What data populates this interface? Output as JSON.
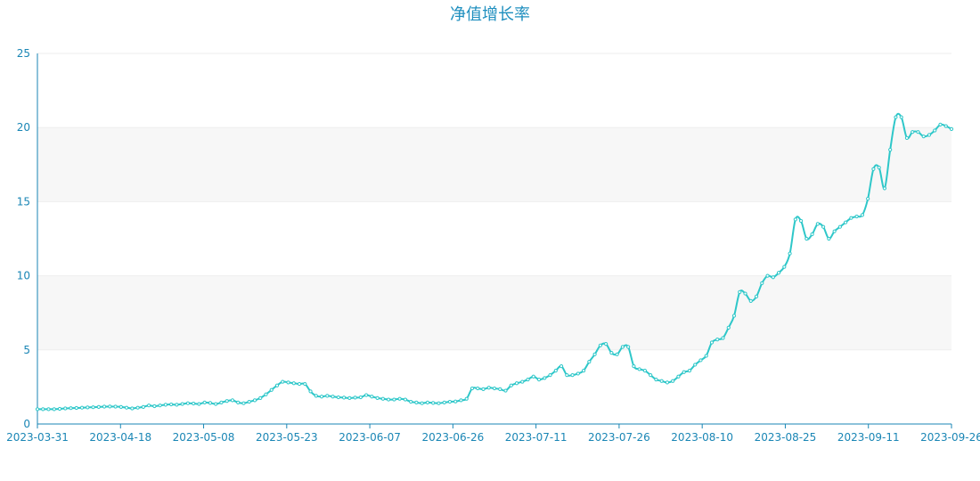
{
  "chart_data": {
    "type": "line",
    "title": "净值增长率",
    "xlabel": "",
    "ylabel": "",
    "ylim": [
      0,
      25
    ],
    "yticks": [
      0,
      5,
      10,
      15,
      20,
      25
    ],
    "x_tick_labels": [
      "2023-03-31",
      "2023-04-18",
      "2023-05-08",
      "2023-05-23",
      "2023-06-07",
      "2023-06-26",
      "2023-07-11",
      "2023-07-26",
      "2023-08-10",
      "2023-08-25",
      "2023-09-11",
      "2023-09-26"
    ],
    "grid": "horizontal bands",
    "legend": "none",
    "line_color": "#2ec7c9",
    "axis_color": "#1a86b5",
    "series": [
      {
        "values": [
          1.0,
          1.0,
          1.0,
          1.0,
          1.02,
          1.05,
          1.07,
          1.08,
          1.1,
          1.12,
          1.13,
          1.15,
          1.17,
          1.18,
          1.17,
          1.15,
          1.1,
          1.05,
          1.1,
          1.15,
          1.25,
          1.2,
          1.25,
          1.3,
          1.32,
          1.3,
          1.35,
          1.4,
          1.38,
          1.35,
          1.45,
          1.42,
          1.35,
          1.45,
          1.55,
          1.6,
          1.45,
          1.4,
          1.5,
          1.6,
          1.75,
          2.0,
          2.3,
          2.6,
          2.85,
          2.8,
          2.75,
          2.7,
          2.7,
          2.2,
          1.9,
          1.85,
          1.9,
          1.85,
          1.8,
          1.78,
          1.75,
          1.78,
          1.8,
          1.95,
          1.85,
          1.75,
          1.7,
          1.65,
          1.65,
          1.7,
          1.65,
          1.5,
          1.45,
          1.4,
          1.45,
          1.42,
          1.4,
          1.45,
          1.5,
          1.52,
          1.6,
          1.7,
          2.4,
          2.4,
          2.35,
          2.45,
          2.4,
          2.35,
          2.25,
          2.6,
          2.75,
          2.85,
          3.0,
          3.2,
          3.0,
          3.1,
          3.3,
          3.6,
          3.9,
          3.3,
          3.3,
          3.4,
          3.6,
          4.2,
          4.7,
          5.3,
          5.4,
          4.8,
          4.7,
          5.2,
          5.2,
          3.9,
          3.7,
          3.6,
          3.3,
          3.0,
          2.9,
          2.8,
          2.9,
          3.2,
          3.5,
          3.6,
          4.0,
          4.3,
          4.6,
          5.5,
          5.7,
          5.8,
          6.5,
          7.3,
          8.9,
          8.8,
          8.3,
          8.6,
          9.5,
          10.0,
          9.9,
          10.2,
          10.6,
          11.5,
          13.8,
          13.7,
          12.5,
          12.8,
          13.5,
          13.3,
          12.5,
          13.0,
          13.3,
          13.6,
          13.9,
          14.0,
          14.1,
          15.2,
          17.2,
          17.3,
          15.9,
          18.5,
          20.7,
          20.7,
          19.3,
          19.7,
          19.7,
          19.4,
          19.5,
          19.8,
          20.2,
          20.1,
          19.9
        ]
      }
    ]
  }
}
